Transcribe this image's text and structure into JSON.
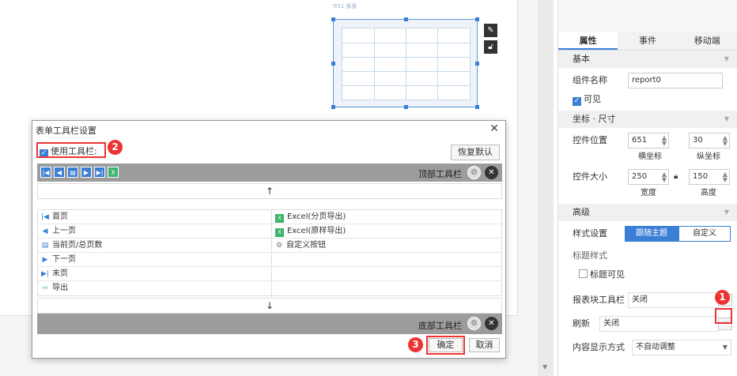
{
  "canvas": {
    "coord_text": "'651 像素"
  },
  "panel": {
    "tabs": [
      "属性",
      "事件",
      "移动端"
    ],
    "section_basic": "基本",
    "component_name_label": "组件名称",
    "component_name_value": "report0",
    "visible_label": "可见",
    "section_coords": "坐标 · 尺寸",
    "position_label": "控件位置",
    "pos_x": "651",
    "pos_y": "30",
    "x_caption": "横坐标",
    "y_caption": "纵坐标",
    "size_label": "控件大小",
    "width": "250",
    "height": "150",
    "width_caption": "宽度",
    "height_caption": "高度",
    "section_advanced": "高级",
    "style_label": "样式设置",
    "style_follow": "跟随主题",
    "style_custom": "自定义",
    "title_style_label": "标题样式",
    "title_visible_label": "标题可见",
    "report_toolbar_label": "报表块工具栏",
    "report_toolbar_value": "关闭",
    "refresh_label": "刷新",
    "refresh_value": "关闭",
    "content_display_label": "内容显示方式",
    "content_display_value": "不自动调整",
    "dots": "···"
  },
  "dialog": {
    "title": "表单工具栏设置",
    "use_toolbar_label": "使用工具栏:",
    "restore_button": "恢复默认",
    "top_toolbar_label": "顶部工具栏",
    "bottom_toolbar_label": "底部工具栏",
    "up_arrow": "↑",
    "down_arrow": "↓",
    "left_items": [
      "首页",
      "上一页",
      "当前页/总页数",
      "下一页",
      "末页",
      "导出"
    ],
    "right_items": [
      "Excel(分页导出)",
      "Excel(原样导出)",
      "自定义按钮"
    ],
    "ok_button": "确定",
    "cancel_button": "取消"
  },
  "badges": [
    "1",
    "2",
    "3"
  ],
  "colors": {
    "accent": "#3a7fd5",
    "highlight": "#e33333",
    "toolbar_band": "#9c9c9c"
  }
}
